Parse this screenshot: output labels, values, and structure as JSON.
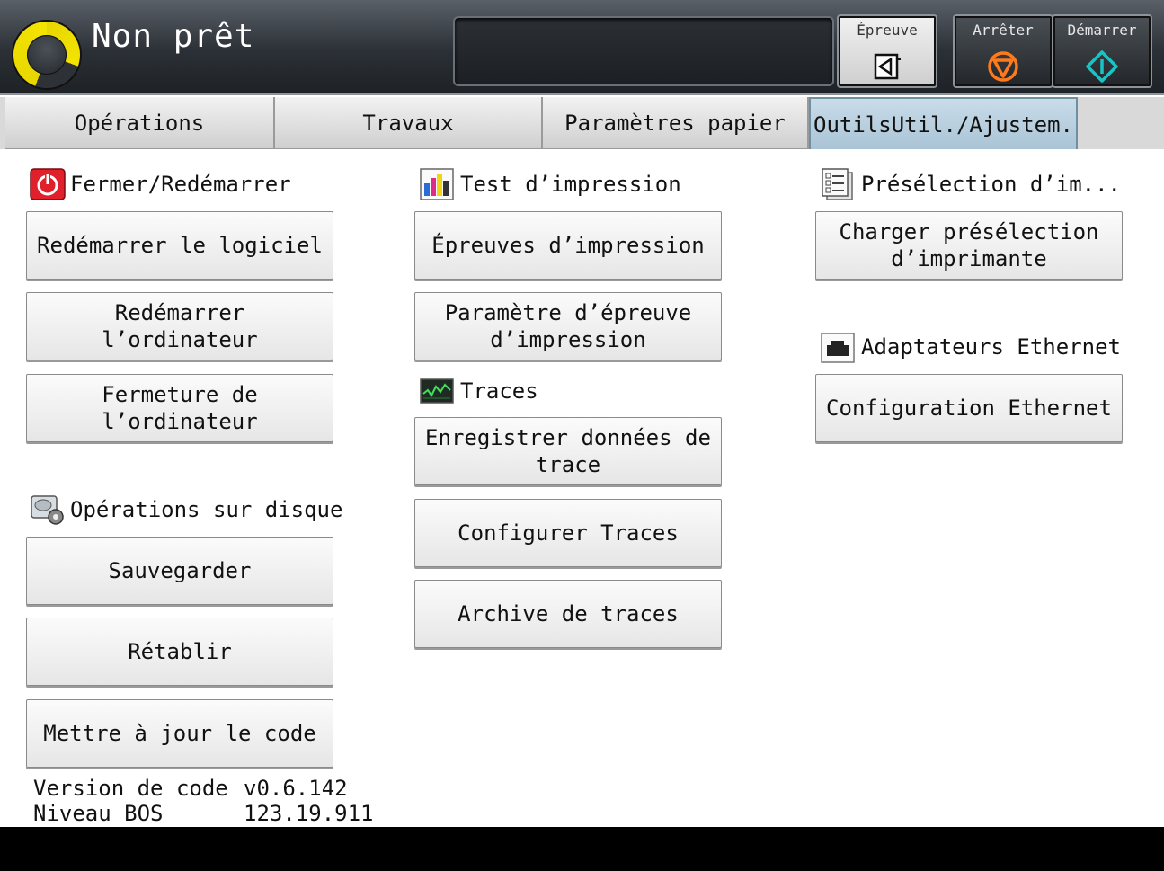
{
  "header": {
    "status": "Non prêt",
    "proof_button": {
      "label": "Épreuve",
      "icon": "proof-arrow-icon"
    },
    "stop_button": {
      "label": "Arrêter",
      "icon": "stop-icon",
      "color": "#ff7a1a"
    },
    "start_button": {
      "label": "Démarrer",
      "icon": "start-icon",
      "color": "#18c4c4"
    },
    "status_color": "#f3e400"
  },
  "tabs": [
    {
      "label": "Opérations"
    },
    {
      "label": "Travaux"
    },
    {
      "label": "Paramètres papier"
    },
    {
      "label": "OutilsUtil./Ajustem.",
      "active": true
    }
  ],
  "sections": {
    "shutdown": {
      "title": "Fermer/Redémarrer",
      "icon": "power-icon",
      "buttons": [
        "Redémarrer le logiciel",
        "Redémarrer l’ordinateur",
        "Fermeture de l’ordinateur"
      ]
    },
    "disk": {
      "title": "Opérations sur disque",
      "icon": "disk-gear-icon",
      "buttons": [
        "Sauvegarder",
        "Rétablir",
        "Mettre à jour le code"
      ]
    },
    "print_test": {
      "title": "Test d’impression",
      "icon": "print-test-icon",
      "buttons": [
        "Épreuves d’impression",
        "Paramètre d’épreuve\nd’impression"
      ]
    },
    "traces": {
      "title": "Traces",
      "icon": "traces-icon",
      "buttons": [
        "Enregistrer données de\ntrace",
        "Configurer Traces",
        "Archive de traces"
      ]
    },
    "preset": {
      "title": "Présélection d’im...",
      "icon": "preset-list-icon",
      "buttons": [
        "Charger présélection\nd’imprimante"
      ]
    },
    "ethernet": {
      "title": "Adaptateurs Ethernet",
      "icon": "ethernet-icon",
      "buttons": [
        "Configuration Ethernet"
      ]
    }
  },
  "info": {
    "code_version_label": "Version de code",
    "code_version": "v0.6.142",
    "bos_label": "Niveau BOS",
    "bos_version": "123.19.911"
  }
}
